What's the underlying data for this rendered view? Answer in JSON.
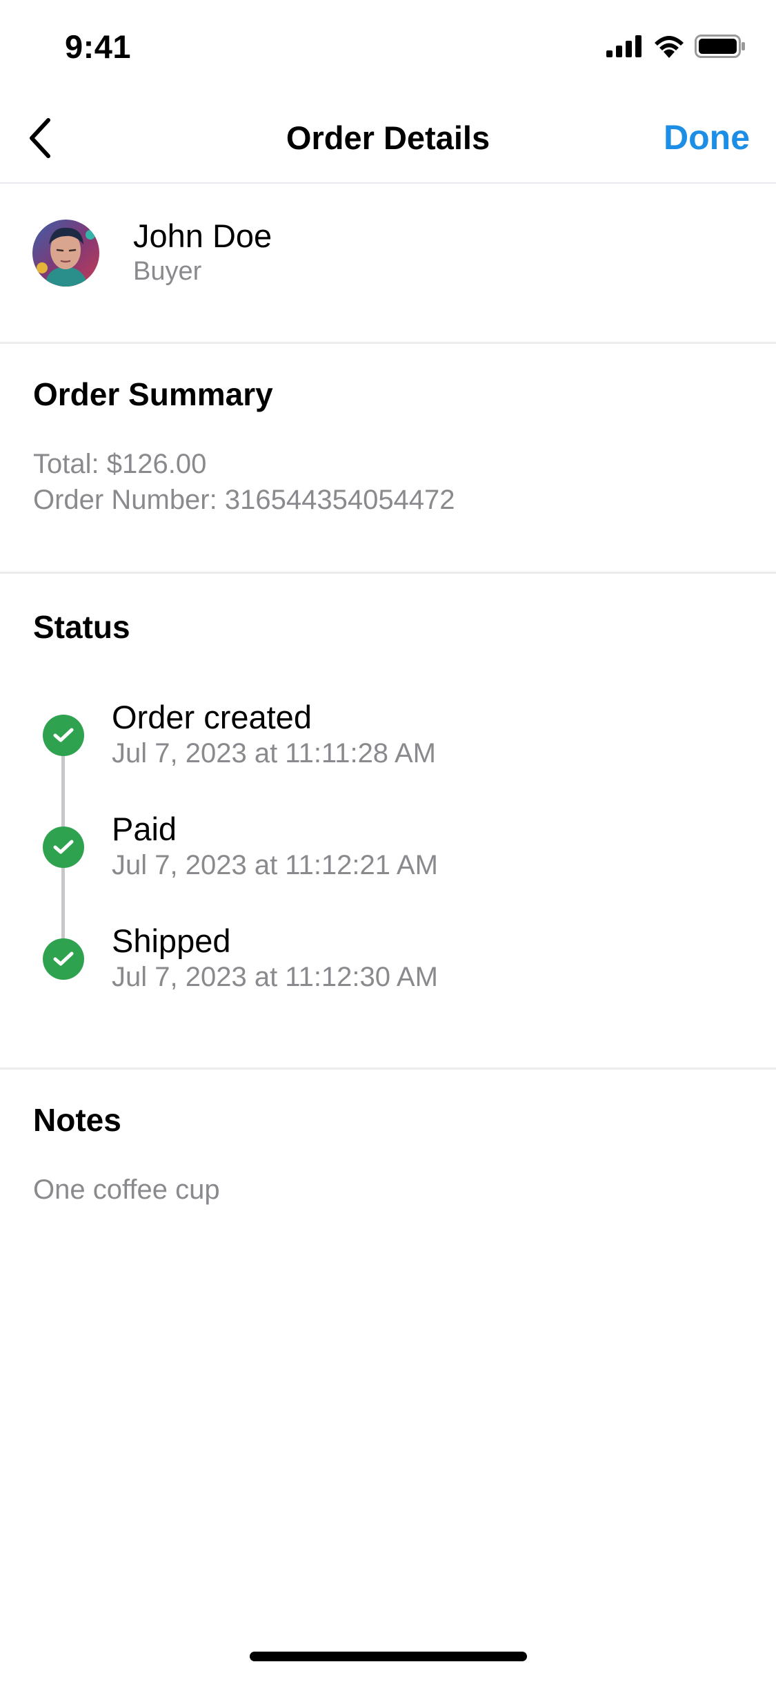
{
  "status_bar": {
    "time": "9:41",
    "icons": [
      "cellular-signal-icon",
      "wifi-icon",
      "battery-icon"
    ]
  },
  "nav": {
    "back_icon": "chevron-left-icon",
    "title": "Order Details",
    "done_label": "Done",
    "accent_color": "#1c8ee6"
  },
  "buyer": {
    "name": "John Doe",
    "role": "Buyer"
  },
  "order_summary": {
    "title": "Order Summary",
    "total": "Total: $126.00",
    "order_number": "Order Number: 316544354054472"
  },
  "status": {
    "title": "Status",
    "check_color": "#2fa24f",
    "steps": [
      {
        "label": "Order created",
        "time": "Jul 7, 2023 at 11:11:28 AM"
      },
      {
        "label": "Paid",
        "time": "Jul 7, 2023 at 11:12:21 AM"
      },
      {
        "label": "Shipped",
        "time": "Jul 7, 2023 at 11:12:30 AM"
      }
    ]
  },
  "notes": {
    "title": "Notes",
    "text": "One coffee cup"
  }
}
